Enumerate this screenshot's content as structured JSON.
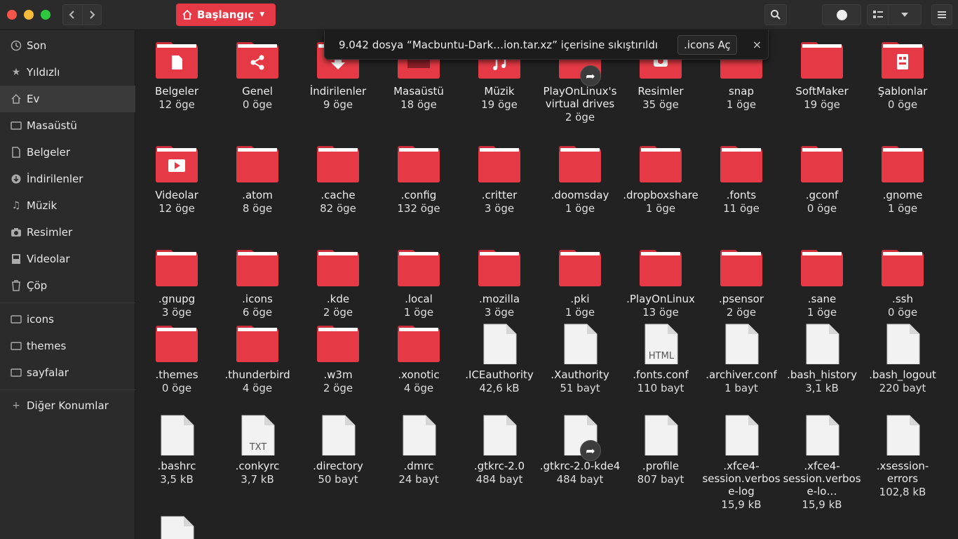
{
  "window": {
    "path_label": "Başlangıç"
  },
  "toast": {
    "message": "9.042 dosya “Macbuntu-Dark…ion.tar.xz” içerisine sıkıştırıldı",
    "open_label": ".icons Aç",
    "close_glyph": "×"
  },
  "sidebar": {
    "items": [
      {
        "label": "Son",
        "icon": "clock-icon"
      },
      {
        "label": "Yıldızlı",
        "icon": "star-icon"
      },
      {
        "label": "Ev",
        "icon": "home-icon"
      },
      {
        "label": "Masaüstü",
        "icon": "desktop-icon"
      },
      {
        "label": "Belgeler",
        "icon": "document-icon"
      },
      {
        "label": "İndirilenler",
        "icon": "download-icon"
      },
      {
        "label": "Müzik",
        "icon": "music-icon"
      },
      {
        "label": "Resimler",
        "icon": "camera-icon"
      },
      {
        "label": "Videolar",
        "icon": "video-icon"
      },
      {
        "label": "Çöp",
        "icon": "trash-icon"
      }
    ],
    "bookmarks": [
      {
        "label": "icons",
        "icon": "folder-icon"
      },
      {
        "label": "themes",
        "icon": "folder-icon"
      },
      {
        "label": "sayfalar",
        "icon": "folder-icon"
      }
    ],
    "other_label": "Diğer Konumlar"
  },
  "files": [
    {
      "name": "Belgeler",
      "count": "12 öge",
      "kind": "folder",
      "emblem": "document"
    },
    {
      "name": "Genel",
      "count": "0 öge",
      "kind": "folder",
      "emblem": "share"
    },
    {
      "name": "İndirilenler",
      "count": "9 öge",
      "kind": "folder",
      "emblem": "download"
    },
    {
      "name": "Masaüstü",
      "count": "18 öge",
      "kind": "folder",
      "emblem": "desktop"
    },
    {
      "name": "Müzik",
      "count": "19 öge",
      "kind": "folder",
      "emblem": "music"
    },
    {
      "name": "PlayOnLinux's virtual drives",
      "count": "2 öge",
      "kind": "folder",
      "emblem": "link"
    },
    {
      "name": "Resimler",
      "count": "35 öge",
      "kind": "folder",
      "emblem": "camera"
    },
    {
      "name": "snap",
      "count": "1 öge",
      "kind": "folder",
      "emblem": ""
    },
    {
      "name": "SoftMaker",
      "count": "19 öge",
      "kind": "folder",
      "emblem": ""
    },
    {
      "name": "Şablonlar",
      "count": "0 öge",
      "kind": "folder",
      "emblem": "template"
    },
    {
      "name": "Videolar",
      "count": "12 öge",
      "kind": "folder",
      "emblem": "video"
    },
    {
      "name": ".atom",
      "count": "8 öge",
      "kind": "folder",
      "emblem": ""
    },
    {
      "name": ".cache",
      "count": "82 öge",
      "kind": "folder",
      "emblem": ""
    },
    {
      "name": ".config",
      "count": "132 öge",
      "kind": "folder",
      "emblem": ""
    },
    {
      "name": ".critter",
      "count": "3 öge",
      "kind": "folder",
      "emblem": ""
    },
    {
      "name": ".doomsday",
      "count": "1 öge",
      "kind": "folder",
      "emblem": ""
    },
    {
      "name": ".dropboxshare",
      "count": "1 öge",
      "kind": "folder",
      "emblem": ""
    },
    {
      "name": ".fonts",
      "count": "11 öge",
      "kind": "folder",
      "emblem": ""
    },
    {
      "name": ".gconf",
      "count": "0 öge",
      "kind": "folder",
      "emblem": ""
    },
    {
      "name": ".gnome",
      "count": "1 öge",
      "kind": "folder",
      "emblem": ""
    },
    {
      "name": ".gnupg",
      "count": "3 öge",
      "kind": "folder",
      "emblem": ""
    },
    {
      "name": ".icons",
      "count": "6 öge",
      "kind": "folder",
      "emblem": ""
    },
    {
      "name": ".kde",
      "count": "2 öge",
      "kind": "folder",
      "emblem": ""
    },
    {
      "name": ".local",
      "count": "1 öge",
      "kind": "folder",
      "emblem": ""
    },
    {
      "name": ".mozilla",
      "count": "3 öge",
      "kind": "folder",
      "emblem": ""
    },
    {
      "name": ".pki",
      "count": "1 öge",
      "kind": "folder",
      "emblem": ""
    },
    {
      "name": ".PlayOnLinux",
      "count": "13 öge",
      "kind": "folder",
      "emblem": ""
    },
    {
      "name": ".psensor",
      "count": "2 öge",
      "kind": "folder",
      "emblem": ""
    },
    {
      "name": ".sane",
      "count": "1 öge",
      "kind": "folder",
      "emblem": ""
    },
    {
      "name": ".ssh",
      "count": "0 öge",
      "kind": "folder",
      "emblem": ""
    },
    {
      "name": ".themes",
      "count": "0 öge",
      "kind": "folder",
      "emblem": ""
    },
    {
      "name": ".thunderbird",
      "count": "4 öge",
      "kind": "folder",
      "emblem": ""
    },
    {
      "name": ".w3m",
      "count": "2 öge",
      "kind": "folder",
      "emblem": ""
    },
    {
      "name": ".xonotic",
      "count": "4 öge",
      "kind": "folder",
      "emblem": ""
    },
    {
      "name": ".ICEauthority",
      "count": "42,6 kB",
      "kind": "file",
      "emblem": ""
    },
    {
      "name": ".Xauthority",
      "count": "51 bayt",
      "kind": "file",
      "emblem": ""
    },
    {
      "name": ".fonts.conf",
      "count": "110 bayt",
      "kind": "file",
      "emblem": "HTML"
    },
    {
      "name": ".archiver.conf",
      "count": "1 bayt",
      "kind": "file",
      "emblem": ""
    },
    {
      "name": ".bash_history",
      "count": "3,1 kB",
      "kind": "file",
      "emblem": ""
    },
    {
      "name": ".bash_logout",
      "count": "220 bayt",
      "kind": "file",
      "emblem": ""
    },
    {
      "name": ".bashrc",
      "count": "3,5 kB",
      "kind": "file",
      "emblem": ""
    },
    {
      "name": ".conkyrc",
      "count": "3,7 kB",
      "kind": "file",
      "emblem": "TXT"
    },
    {
      "name": ".directory",
      "count": "50 bayt",
      "kind": "file",
      "emblem": ""
    },
    {
      "name": ".dmrc",
      "count": "24 bayt",
      "kind": "file",
      "emblem": ""
    },
    {
      "name": ".gtkrc-2.0",
      "count": "484 bayt",
      "kind": "file",
      "emblem": ""
    },
    {
      "name": ".gtkrc-2.0-kde4",
      "count": "484 bayt",
      "kind": "file",
      "emblem": "link"
    },
    {
      "name": ".profile",
      "count": "807 bayt",
      "kind": "file",
      "emblem": ""
    },
    {
      "name": ".xfce4-session.verbose-log",
      "count": "15,9 kB",
      "kind": "file",
      "emblem": ""
    },
    {
      "name": ".xfce4-session.verbose-lo…",
      "count": "15,9 kB",
      "kind": "file",
      "emblem": ""
    },
    {
      "name": ".xsession-errors",
      "count": "102,8 kB",
      "kind": "file",
      "emblem": ""
    },
    {
      "name": "",
      "count": "",
      "kind": "file",
      "emblem": ""
    }
  ],
  "colors": {
    "accent": "#e53a45",
    "folder": "#e53a45",
    "folder_tab": "#c92f3a"
  }
}
